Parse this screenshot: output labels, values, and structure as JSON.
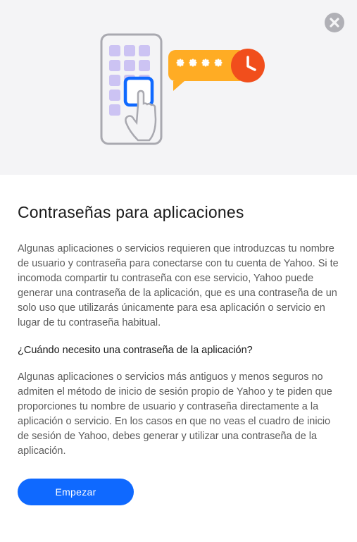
{
  "title": "Contraseñas para aplicaciones",
  "paragraph1": "Algunas aplicaciones o servicios requieren que introduzcas tu nombre de usuario y contraseña para conectarse con tu cuenta de Yahoo. Si te incomoda compartir tu contraseña con ese servicio, Yahoo puede generar una contraseña de la aplicación, que es una contraseña de un solo uso que utilizarás únicamente para esa aplicación o servicio en lugar de tu contraseña habitual.",
  "subtitle": "¿Cuándo necesito una contraseña de la aplicación?",
  "paragraph2": "Algunas aplicaciones o servicios más antiguos y menos seguros no admiten el método de inicio de sesión propio de Yahoo y te piden que proporciones tu nombre de usuario y contraseña directamente a la aplicación o servicio. En los casos en que no veas el cuadro de inicio de sesión de Yahoo, debes generar y utilizar una contraseña de la aplicación.",
  "startButtonLabel": "Empezar",
  "colors": {
    "primary": "#0f69ff",
    "orange": "#fb8b1e",
    "redOrange": "#f14e1c",
    "purple": "#ccc3f3",
    "tooltipBg": "#ffac24"
  }
}
